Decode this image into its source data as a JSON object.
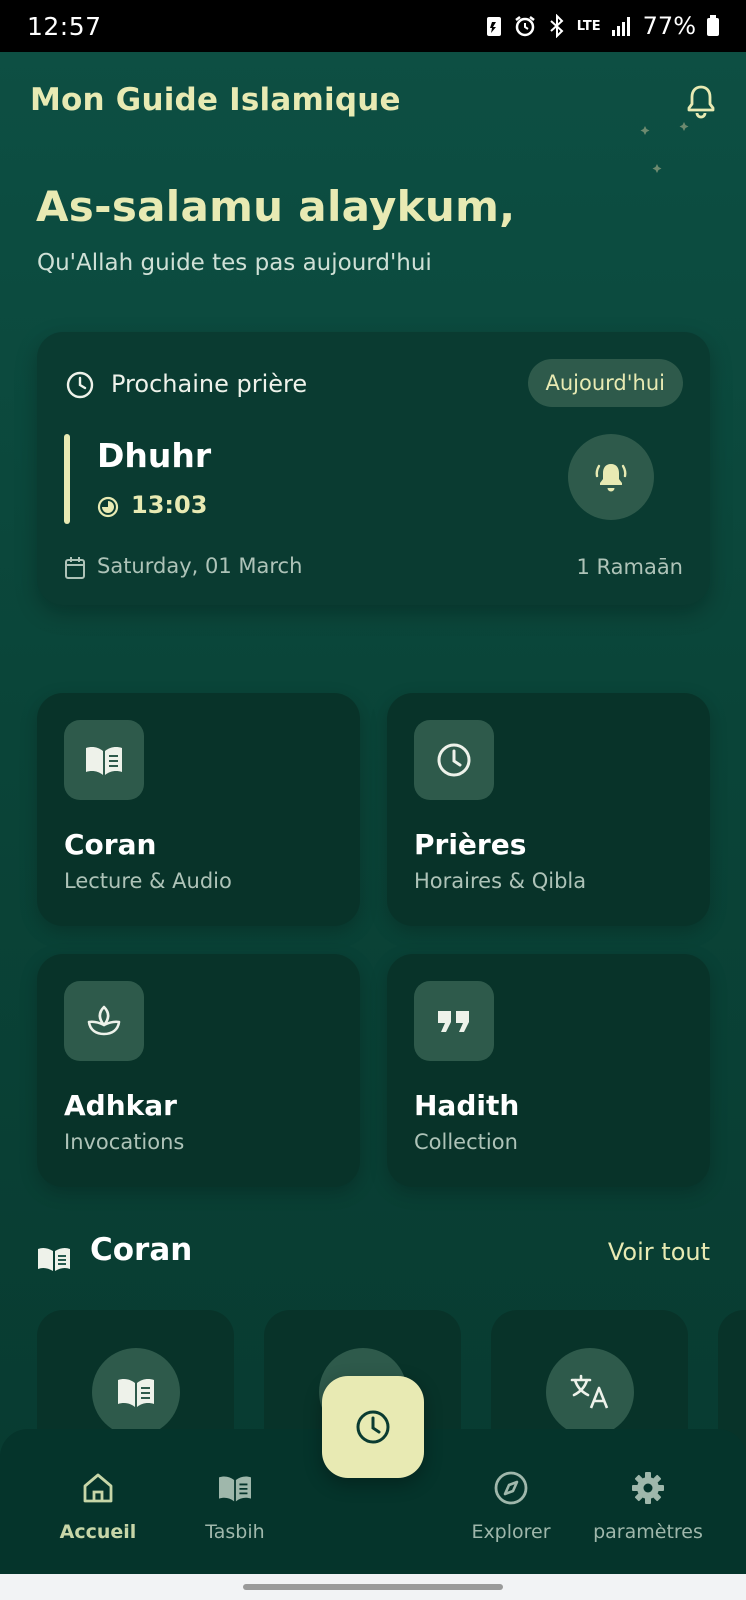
{
  "status_bar": {
    "time": "12:57",
    "network": "LTE",
    "battery": "77%"
  },
  "header": {
    "app_title": "Mon Guide Islamique",
    "greeting": "As-salamu alaykum,",
    "subgreeting": "Qu'Allah guide tes pas aujourd'hui"
  },
  "next_prayer": {
    "label": "Prochaine prière",
    "badge": "Aujourd'hui",
    "name": "Dhuhr",
    "time": "13:03",
    "date": "Saturday, 01 March",
    "hijri_date": "1 Ramaān"
  },
  "tiles": [
    {
      "title": "Coran",
      "subtitle": "Lecture & Audio",
      "icon": "book-open-icon"
    },
    {
      "title": "Prières",
      "subtitle": "Horaires & Qibla",
      "icon": "clock-icon"
    },
    {
      "title": "Adhkar",
      "subtitle": "Invocations",
      "icon": "lotus-icon"
    },
    {
      "title": "Hadith",
      "subtitle": "Collection",
      "icon": "quote-icon"
    }
  ],
  "quran_section": {
    "title": "Coran",
    "see_all": "Voir tout",
    "cards": [
      {
        "icon": "book-open-icon"
      },
      {
        "icon": "bookmark-icon"
      },
      {
        "icon": "translate-icon"
      }
    ]
  },
  "bottom_nav": {
    "items": [
      {
        "label": "Accueil",
        "icon": "home-icon",
        "active": true
      },
      {
        "label": "Tasbih",
        "icon": "book-icon",
        "active": false
      },
      {
        "label": "Explorer",
        "icon": "compass-icon",
        "active": false
      },
      {
        "label": "paramètres",
        "icon": "gear-icon",
        "active": false
      }
    ],
    "fab_icon": "clock-icon"
  },
  "colors": {
    "accent": "#e8eab3",
    "background": "#0b3d34",
    "card": "#0a3b31",
    "icon_bg": "#2e5a4b"
  }
}
